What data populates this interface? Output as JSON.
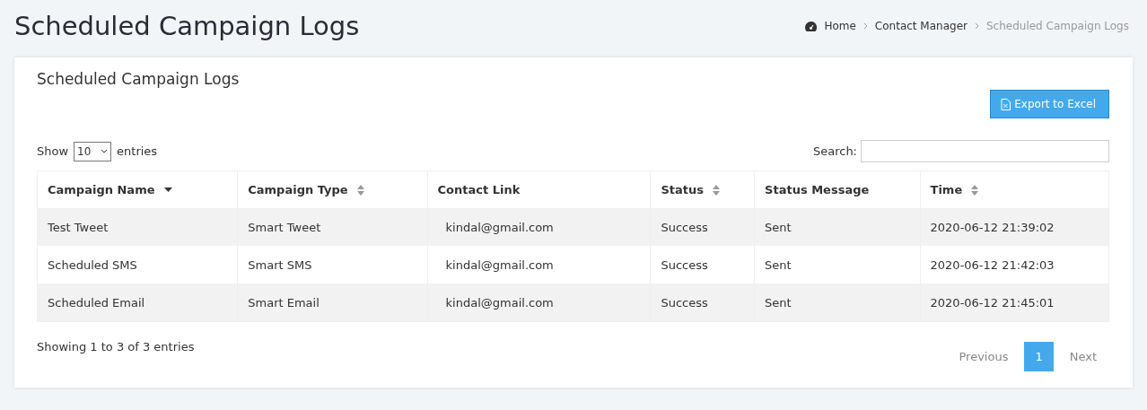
{
  "page_title": "Scheduled Campaign Logs",
  "breadcrumbs": [
    {
      "label": "Home",
      "current": false,
      "kind": "home"
    },
    {
      "label": "Contact Manager",
      "current": false,
      "kind": "link"
    },
    {
      "label": "Scheduled Campaign Logs",
      "current": true,
      "kind": "link"
    }
  ],
  "card": {
    "title": "Scheduled Campaign Logs",
    "export_button": "Export to Excel",
    "length": {
      "before": "Show",
      "value": "10",
      "after": "entries"
    },
    "search": {
      "label": "Search:"
    },
    "table": {
      "columns": [
        {
          "label": "Campaign Name",
          "sortable": true,
          "sorted": true
        },
        {
          "label": "Campaign Type",
          "sortable": true,
          "sorted": false
        },
        {
          "label": "Contact Link",
          "sortable": false
        },
        {
          "label": "Status",
          "sortable": true,
          "sorted": false
        },
        {
          "label": "Status Message",
          "sortable": false
        },
        {
          "label": "Time",
          "sortable": true,
          "sorted": false
        }
      ],
      "rows": [
        [
          "Test Tweet",
          "Smart Tweet",
          "kindal@gmail.com",
          "Success",
          "Sent",
          "2020-06-12 21:39:02"
        ],
        [
          "Scheduled SMS",
          "Smart SMS",
          "kindal@gmail.com",
          "Success",
          "Sent",
          "2020-06-12 21:42:03"
        ],
        [
          "Scheduled Email",
          "Smart Email",
          "kindal@gmail.com",
          "Success",
          "Sent",
          "2020-06-12 21:45:01"
        ]
      ]
    },
    "info": "Showing 1 to 3 of 3 entries",
    "pagination": {
      "previous": "Previous",
      "pages": [
        {
          "label": "1",
          "selected": true
        }
      ],
      "next": "Next"
    }
  }
}
